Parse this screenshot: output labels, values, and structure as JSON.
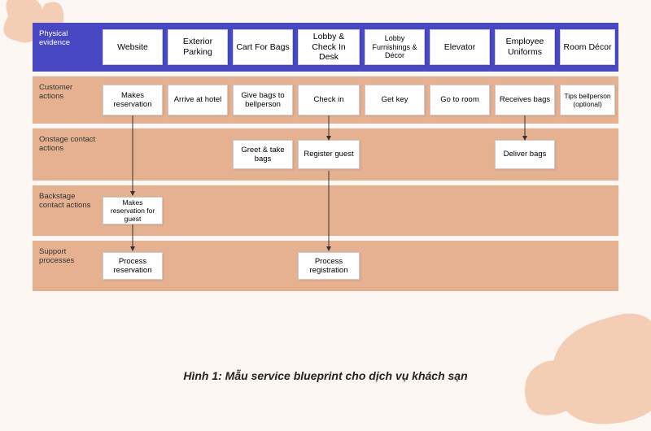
{
  "rows": {
    "physical": {
      "label": "Physical evidence",
      "cards": [
        "Website",
        "Exterior Parking",
        "Cart For Bags",
        "Lobby & Check In Desk",
        "Lobby Furnishings & Décor",
        "Elevator",
        "Employee Uniforms",
        "Room Décor"
      ]
    },
    "customer": {
      "label": "Customer actions",
      "cards": [
        "Makes reservation",
        "Arrive at hotel",
        "Give bags to bellperson",
        "Check in",
        "Get key",
        "Go to room",
        "Receives bags",
        "Tips bellperson (optional)"
      ]
    },
    "onstage": {
      "label": "Onstage contact actions",
      "cards": {
        "2": "Greet & take bags",
        "3": "Register guest",
        "6": "Deliver bags"
      }
    },
    "backstage": {
      "label": "Backstage contact actions",
      "cards": {
        "0": "Makes reservation for guest"
      }
    },
    "support": {
      "label": "Support processes",
      "cards": {
        "0": "Process reservation",
        "3": "Process registration"
      }
    }
  },
  "caption": "Hình 1: Mẫu service blueprint cho dịch vụ khách sạn",
  "chart_data": {
    "type": "table",
    "title": "Service blueprint for hotel service",
    "columns": [
      "Col0",
      "Col1",
      "Col2",
      "Col3",
      "Col4",
      "Col5",
      "Col6",
      "Col7"
    ],
    "rows": [
      {
        "name": "Physical evidence",
        "cells": [
          "Website",
          "Exterior Parking",
          "Cart For Bags",
          "Lobby & Check In Desk",
          "Lobby Furnishings & Décor",
          "Elevator",
          "Employee Uniforms",
          "Room Décor"
        ]
      },
      {
        "name": "Customer actions",
        "cells": [
          "Makes reservation",
          "Arrive at hotel",
          "Give bags to bellperson",
          "Check in",
          "Get key",
          "Go to room",
          "Receives bags",
          "Tips bellperson (optional)"
        ]
      },
      {
        "name": "Onstage contact actions",
        "cells": [
          "",
          "",
          "Greet & take bags",
          "Register guest",
          "",
          "",
          "Deliver bags",
          ""
        ]
      },
      {
        "name": "Backstage contact actions",
        "cells": [
          "Makes reservation for guest",
          "",
          "",
          "",
          "",
          "",
          "",
          ""
        ]
      },
      {
        "name": "Support processes",
        "cells": [
          "Process reservation",
          "",
          "",
          "Process registration",
          "",
          "",
          "",
          ""
        ]
      }
    ],
    "arrows": [
      {
        "from": "Customer actions:Makes reservation",
        "to": "Backstage contact actions:Makes reservation for guest"
      },
      {
        "from": "Backstage contact actions:Makes reservation for guest",
        "to": "Support processes:Process reservation"
      },
      {
        "from": "Customer actions:Check in",
        "to": "Onstage contact actions:Register guest"
      },
      {
        "from": "Onstage contact actions:Register guest",
        "to": "Support processes:Process registration"
      },
      {
        "from": "Customer actions:Receives bags",
        "to": "Onstage contact actions:Deliver bags"
      }
    ]
  }
}
